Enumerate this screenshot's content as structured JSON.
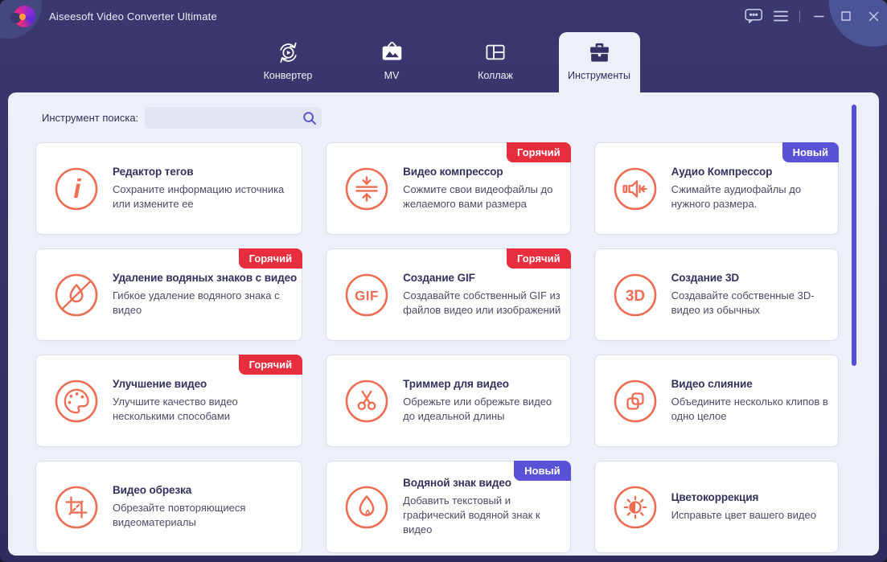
{
  "window": {
    "title": "Aiseesoft Video Converter Ultimate",
    "controls": [
      {
        "name": "feedback-button",
        "icon": "chat-icon"
      },
      {
        "name": "menu-button",
        "icon": "hamburger-icon"
      },
      {
        "name": "separator",
        "icon": "separator"
      },
      {
        "name": "minimize-button",
        "icon": "minimize-icon"
      },
      {
        "name": "maximize-button",
        "icon": "maximize-icon"
      },
      {
        "name": "close-button",
        "icon": "close-icon"
      }
    ]
  },
  "tabs": [
    {
      "label": "Конвертер",
      "icon": "converter-icon",
      "active": false
    },
    {
      "label": "MV",
      "icon": "mv-icon",
      "active": false
    },
    {
      "label": "Коллаж",
      "icon": "collage-icon",
      "active": false
    },
    {
      "label": "Инструменты",
      "icon": "toolbox-icon",
      "active": true
    }
  ],
  "search": {
    "label": "Инструмент поиска:",
    "value": "",
    "icon": "search-icon"
  },
  "badge_labels": {
    "hot": "Горячий",
    "new": "Новый"
  },
  "tools": [
    {
      "title": "Редактор тегов",
      "desc": "Сохраните информацию источника или измените ее",
      "icon": "info-icon",
      "badge": null
    },
    {
      "title": "Видео компрессор",
      "desc": "Сожмите свои видеофайлы до желаемого вами размера",
      "icon": "compress-icon",
      "badge": "hot"
    },
    {
      "title": "Аудио Компрессор",
      "desc": "Сжимайте аудиофайлы до нужного размера.",
      "icon": "audio-compress-icon",
      "badge": "new"
    },
    {
      "title": "Удаление водяных знаков с видео",
      "desc": "Гибкое удаление водяного знака с видео",
      "icon": "no-watermark-icon",
      "badge": "hot"
    },
    {
      "title": "Создание GIF",
      "desc": "Создавайте собственный GIF из файлов видео или изображений",
      "icon": "gif-icon",
      "badge": "hot"
    },
    {
      "title": "Создание 3D",
      "desc": "Создавайте собственные 3D-видео из обычных",
      "icon": "3d-icon",
      "badge": null
    },
    {
      "title": "Улучшение видео",
      "desc": "Улучшите качество видео несколькими способами",
      "icon": "palette-icon",
      "badge": "hot"
    },
    {
      "title": "Триммер для видео",
      "desc": "Обрежьте или обрежьте видео до идеальной длины",
      "icon": "scissors-icon",
      "badge": null
    },
    {
      "title": "Видео слияние",
      "desc": "Объедините несколько клипов в одно целое",
      "icon": "merge-icon",
      "badge": null
    },
    {
      "title": "Видео обрезка",
      "desc": "Обрезайте повторяющиеся видеоматериалы",
      "icon": "crop-icon",
      "badge": null
    },
    {
      "title": "Водяной знак видео",
      "desc": "Добавить текстовый и графический водяной знак к видео",
      "icon": "watermark-icon",
      "badge": "new"
    },
    {
      "title": "Цветокоррекция",
      "desc": "Исправьте цвет вашего видео",
      "icon": "color-correction-icon",
      "badge": null
    }
  ],
  "colors": {
    "frame": "#343164",
    "frame_light": "#3b3870",
    "frame_dark": "#2e2b5e",
    "panel": "#eef0f9",
    "accent": "#ed6c53",
    "badge_hot": "#e62e3e",
    "badge_new": "#5a52d6",
    "scrollbar": "#514fd8",
    "search_icon": "#5a55c8"
  }
}
